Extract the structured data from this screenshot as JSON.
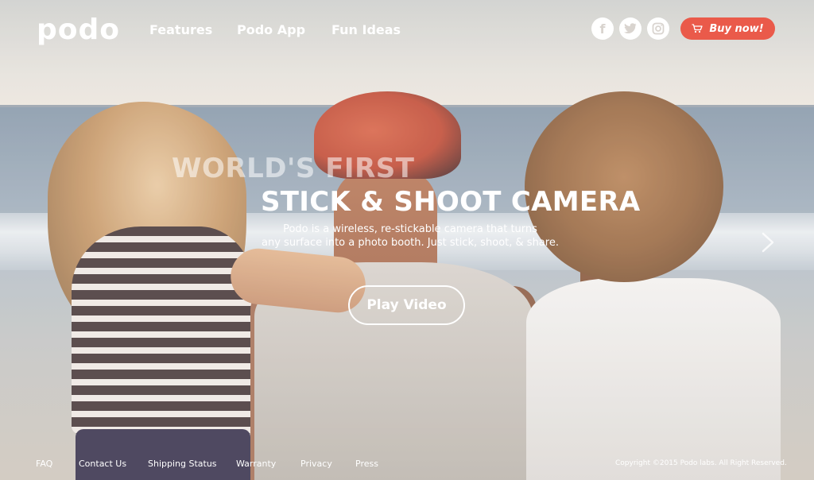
{
  "brand": {
    "logo_text": "podo"
  },
  "nav": {
    "items": [
      {
        "label": "Features"
      },
      {
        "label": "Podo App"
      },
      {
        "label": "Fun Ideas"
      }
    ]
  },
  "social": {
    "facebook_glyph": "f",
    "twitter_glyph": "t",
    "instagram_glyph": "◎"
  },
  "buy_button": {
    "label": "Buy now!",
    "icon": "cart-icon",
    "color": "#ea5a4a"
  },
  "hero": {
    "headline_top": "WORLD'S FIRST",
    "headline_main": "STICK & SHOOT CAMERA",
    "description_line1": "Podo is a wireless, re-stickable camera that turns",
    "description_line2": "any surface into a photo booth. Just stick, shoot, & share.",
    "play_button_label": "Play Video",
    "next_icon": "chevron-right-icon"
  },
  "footer": {
    "links": [
      {
        "label": "FAQ"
      },
      {
        "label": "Contact Us"
      },
      {
        "label": "Shipping Status"
      },
      {
        "label": "Warranty"
      },
      {
        "label": "Privacy"
      },
      {
        "label": "Press"
      }
    ],
    "copyright": "Copyright ©2015 Podo labs. All Right Reserved."
  }
}
